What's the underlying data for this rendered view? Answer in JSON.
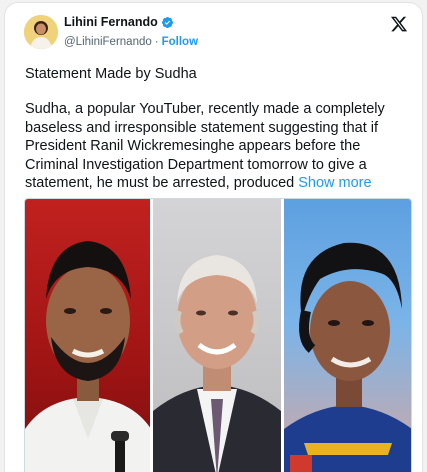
{
  "author": {
    "name": "Lihini Fernando",
    "handle": "@LihiniFernando",
    "separator": "·",
    "follow_label": "Follow",
    "verified": true
  },
  "icons": {
    "verified": "verified-badge-icon",
    "platform": "x-logo-icon"
  },
  "post": {
    "title": "Statement Made by Sudha",
    "body": "Sudha, a popular YouTuber, recently made a completely baseless and irresponsible statement suggesting that if President Ranil Wickremesinghe appears before the Criminal Investigation Department tomorrow to give a statement, he must be arrested, produced",
    "show_more_label": "Show more"
  },
  "colors": {
    "accent": "#1d9bf0",
    "text": "#0f1419",
    "muted": "#536471"
  }
}
